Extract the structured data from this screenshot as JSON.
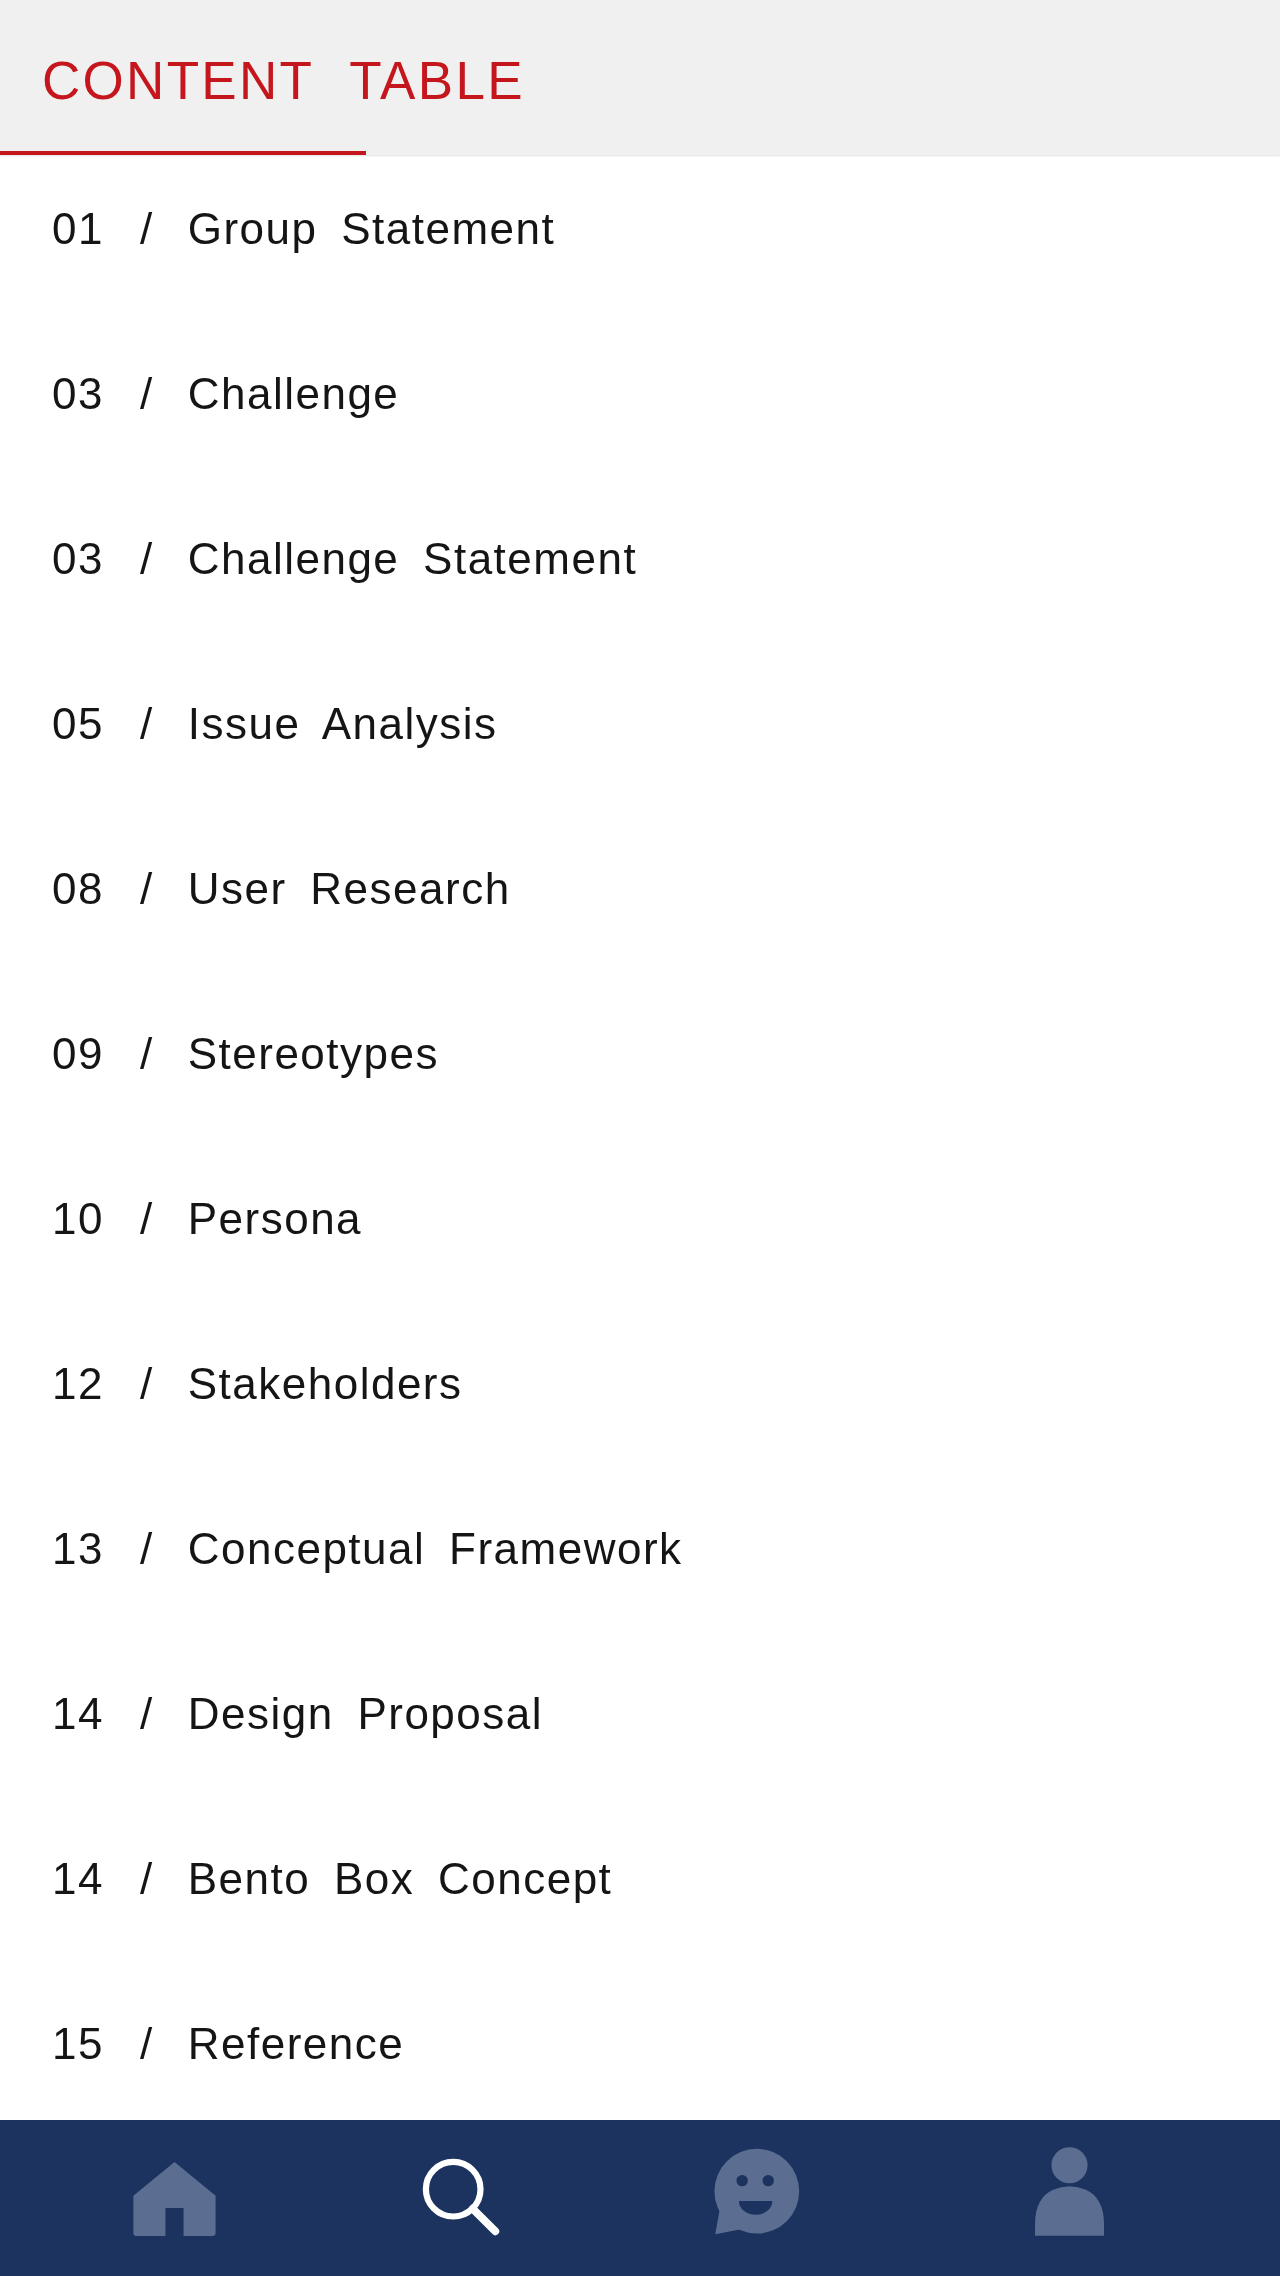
{
  "header": {
    "title": "CONTENT TABLE"
  },
  "contents": [
    {
      "number": "01",
      "separator": "/",
      "title": "Group Statement"
    },
    {
      "number": "03",
      "separator": "/",
      "title": "Challenge"
    },
    {
      "number": "03",
      "separator": "/",
      "title": "Challenge Statement"
    },
    {
      "number": "05",
      "separator": "/",
      "title": "Issue Analysis"
    },
    {
      "number": "08",
      "separator": "/",
      "title": "User Research"
    },
    {
      "number": "09",
      "separator": "/",
      "title": "Stereotypes"
    },
    {
      "number": "10",
      "separator": "/",
      "title": "Persona"
    },
    {
      "number": "12",
      "separator": "/",
      "title": "Stakeholders"
    },
    {
      "number": "13",
      "separator": "/",
      "title": "Conceptual Framework"
    },
    {
      "number": "14",
      "separator": "/",
      "title": "Design Proposal"
    },
    {
      "number": "14",
      "separator": "/",
      "title": "Bento Box Concept"
    },
    {
      "number": "15",
      "separator": "/",
      "title": "Reference"
    }
  ],
  "nav": {
    "items": [
      {
        "kind": "home",
        "selected": false
      },
      {
        "kind": "search",
        "selected": true
      },
      {
        "kind": "chat",
        "selected": false
      },
      {
        "kind": "profile",
        "selected": false
      }
    ]
  }
}
